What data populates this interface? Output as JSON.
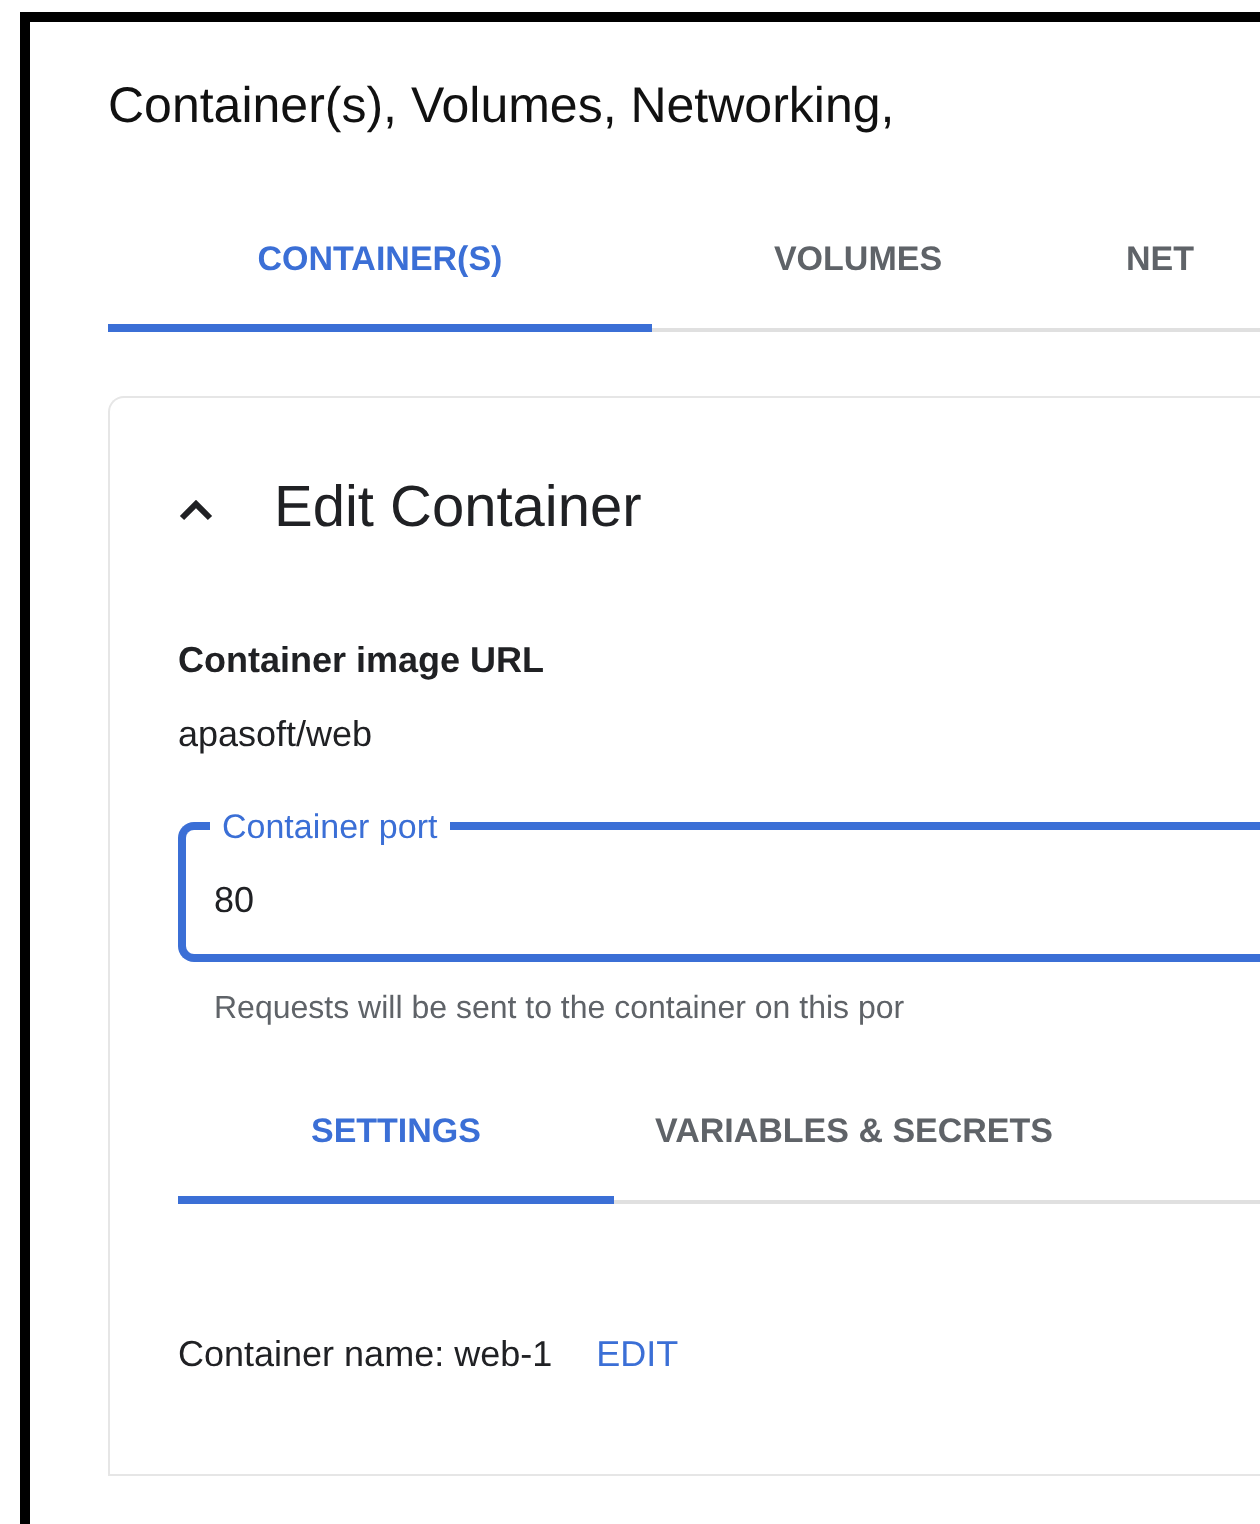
{
  "heading": "Container(s), Volumes, Networking,",
  "tabs": [
    {
      "label": "CONTAINER(S)",
      "selected": true
    },
    {
      "label": "VOLUMES",
      "selected": false
    },
    {
      "label": "NET",
      "selected": false
    }
  ],
  "panel": {
    "title": "Edit Container",
    "expanded": true,
    "image_label": "Container image URL",
    "image_value": "apasoft/web",
    "port_field": {
      "label": "Container port",
      "value": "80",
      "focused": true,
      "helper": "Requests will be sent to the container on this por"
    },
    "subtabs": [
      {
        "label": "SETTINGS",
        "selected": true
      },
      {
        "label": "VARIABLES & SECRETS",
        "selected": false
      }
    ],
    "name_text": "Container name: web-1",
    "edit_link": "EDIT"
  }
}
